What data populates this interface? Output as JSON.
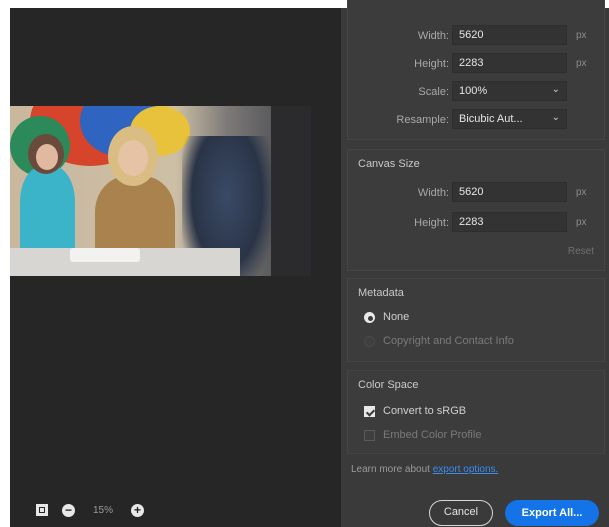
{
  "preview": {
    "zoom_level": "15%"
  },
  "image_size": {
    "width_label": "Width:",
    "width_value": "5620",
    "width_unit": "px",
    "height_label": "Height:",
    "height_value": "2283",
    "height_unit": "px",
    "scale_label": "Scale:",
    "scale_value": "100%",
    "resample_label": "Resample:",
    "resample_value": "Bicubic Aut..."
  },
  "canvas_size": {
    "title": "Canvas Size",
    "width_label": "Width:",
    "width_value": "5620",
    "width_unit": "px",
    "height_label": "Height:",
    "height_value": "2283",
    "height_unit": "px",
    "reset_label": "Reset"
  },
  "metadata": {
    "title": "Metadata",
    "options": [
      {
        "label": "None",
        "selected": true
      },
      {
        "label": "Copyright and Contact Info",
        "selected": false
      }
    ]
  },
  "color_space": {
    "title": "Color Space",
    "options": [
      {
        "label": "Convert to sRGB",
        "checked": true
      },
      {
        "label": "Embed Color Profile",
        "checked": false
      }
    ]
  },
  "footer": {
    "learn_more_text": "Learn more about",
    "learn_more_link": "export options.",
    "cancel_label": "Cancel",
    "export_label": "Export All..."
  },
  "colors": {
    "accent": "#1473e6",
    "panel_bg": "#3a3a3a",
    "preview_bg": "#262626"
  }
}
